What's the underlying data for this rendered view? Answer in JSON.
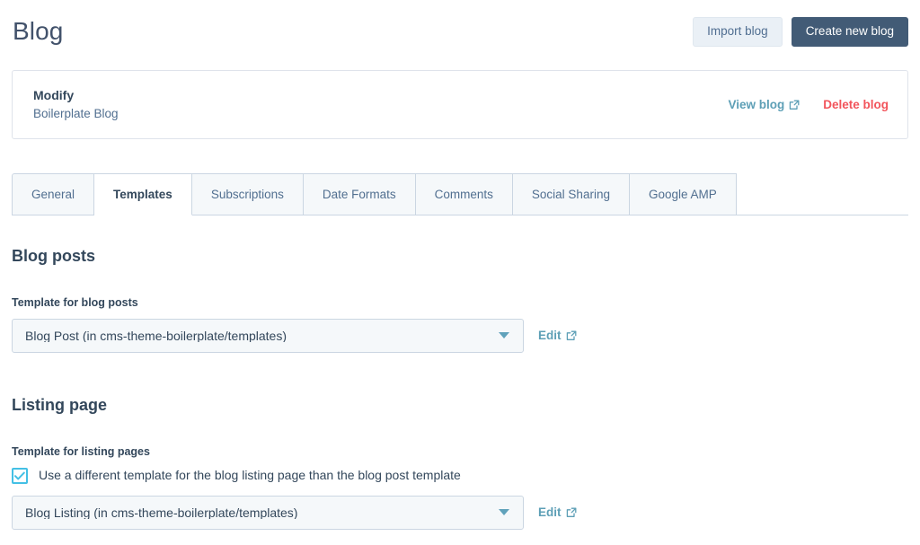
{
  "header": {
    "title": "Blog",
    "import_label": "Import blog",
    "create_label": "Create new blog"
  },
  "modify_card": {
    "title": "Modify",
    "subtitle": "Boilerplate Blog",
    "view_label": "View blog",
    "delete_label": "Delete blog"
  },
  "tabs": [
    {
      "label": "General",
      "active": false
    },
    {
      "label": "Templates",
      "active": true
    },
    {
      "label": "Subscriptions",
      "active": false
    },
    {
      "label": "Date Formats",
      "active": false
    },
    {
      "label": "Comments",
      "active": false
    },
    {
      "label": "Social Sharing",
      "active": false
    },
    {
      "label": "Google AMP",
      "active": false
    }
  ],
  "blog_posts_section": {
    "heading": "Blog posts",
    "field_label": "Template for blog posts",
    "select_value": "Blog Post (in cms-theme-boilerplate/templates)",
    "edit_label": "Edit"
  },
  "listing_section": {
    "heading": "Listing page",
    "field_label": "Template for listing pages",
    "checkbox_label": "Use a different template for the blog listing page than the blog post template",
    "checkbox_checked": true,
    "select_value": "Blog Listing (in cms-theme-boilerplate/templates)",
    "edit_label": "Edit"
  },
  "colors": {
    "primary_button": "#425b76",
    "secondary_button": "#eaf0f6",
    "link_teal": "#5d9fb6",
    "danger_red": "#f2545b",
    "checkbox_accent": "#44c0e5",
    "text_dark": "#33475b",
    "text_muted": "#516f90",
    "border": "#cbd6e2",
    "field_bg": "#f5f8fa"
  }
}
